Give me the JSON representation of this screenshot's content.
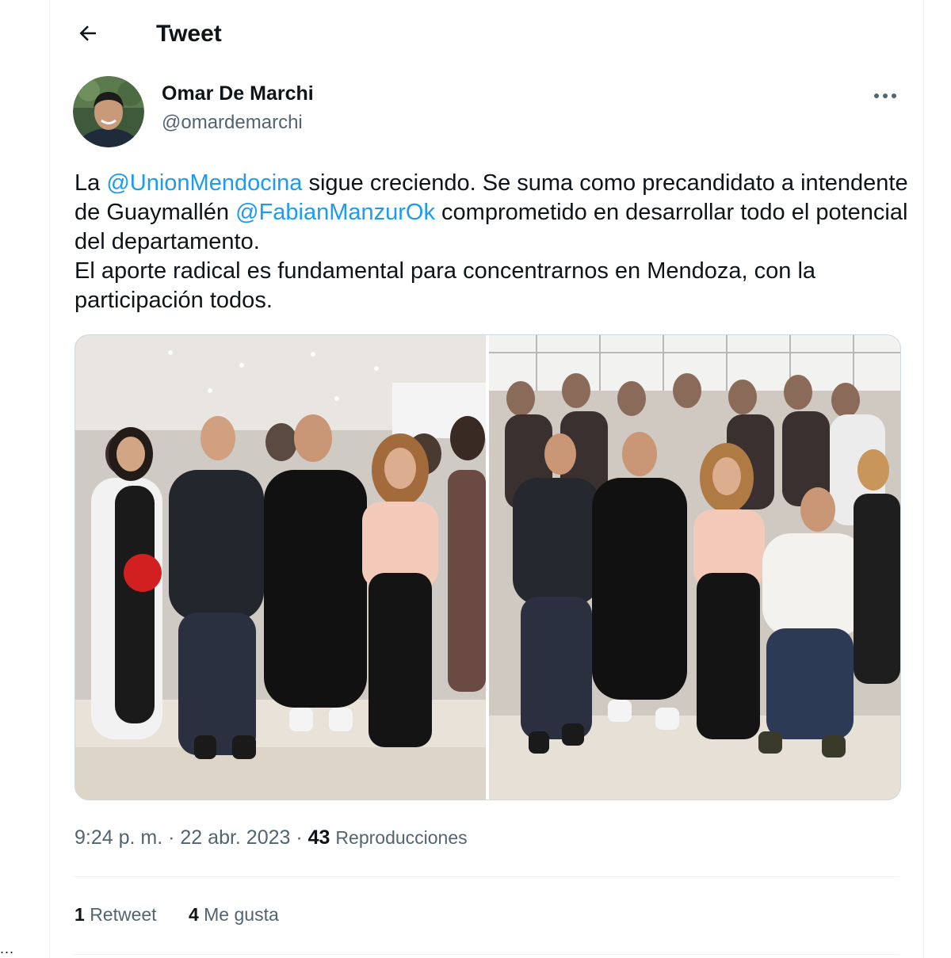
{
  "header": {
    "title": "Tweet",
    "back_icon": "arrow-left-icon"
  },
  "author": {
    "name": "Omar De Marchi",
    "handle": "@omardemarchi",
    "more_icon": "more-horizontal-icon"
  },
  "tweet": {
    "segments": [
      {
        "type": "text",
        "text": "La "
      },
      {
        "type": "mention",
        "text": "@UnionMendocina"
      },
      {
        "type": "text",
        "text": " sigue creciendo. Se suma como precandidato a intendente de Guaymallén "
      },
      {
        "type": "mention",
        "text": "@FabianManzurOk"
      },
      {
        "type": "text",
        "text": " comprometido en desarrollar todo el potencial del departamento."
      },
      {
        "type": "break"
      },
      {
        "type": "text",
        "text": "El aporte radical es fundamental para concentrarnos en Mendoza, con la participación todos."
      }
    ],
    "mention_color": "#1d9bf0"
  },
  "meta": {
    "time": "9:24 p. m.",
    "separator": "·",
    "date": "22 abr. 2023",
    "views_count": "43",
    "views_label": "Reproducciones"
  },
  "stats": {
    "retweets_count": "1",
    "retweets_label": "Retweet",
    "likes_count": "4",
    "likes_label": "Me gusta"
  },
  "sidebar": {
    "more_dots": "..."
  }
}
